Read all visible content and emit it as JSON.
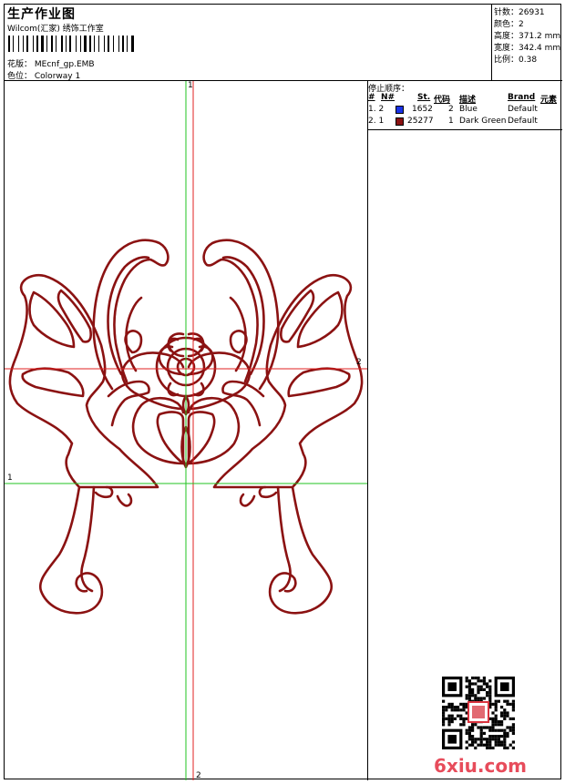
{
  "header": {
    "title": "生产作业图",
    "studio": "Wilcom(汇家) 绣饰工作室",
    "design_label": "花版：",
    "design_file": "MEcnf_gp.EMB",
    "colorway_label": "色位：",
    "colorway": "Colorway 1"
  },
  "stats": [
    {
      "label": "针数：",
      "value": "26931"
    },
    {
      "label": "颜色：",
      "value": "2"
    },
    {
      "label": "高度：",
      "value": "371.2 mm"
    },
    {
      "label": "宽度：",
      "value": "342.4 mm"
    },
    {
      "label": "比例：",
      "value": "0.38"
    }
  ],
  "stop_sequence": {
    "title": "停止顺序：",
    "headers": [
      "#",
      "N#",
      "St.",
      "代码",
      "描述",
      "Brand",
      "元素"
    ],
    "rows": [
      {
        "no": "1. 2",
        "stitches": "1652",
        "code": "2",
        "desc": "Blue",
        "brand": "Default",
        "color": "#1a33e6"
      },
      {
        "no": "2. 1",
        "stitches": "25277",
        "code": "1",
        "desc": "Dark Green",
        "brand": "Default",
        "color": "#8b1212"
      }
    ]
  },
  "axes": {
    "vertical_1": "1",
    "vertical_2": "2",
    "horizontal_1": "1",
    "horizontal_2": "2"
  },
  "colors": {
    "outline": "#8b1212",
    "axis_green": "#22c322",
    "axis_red": "#e02020"
  },
  "watermark": "6xiu.com"
}
